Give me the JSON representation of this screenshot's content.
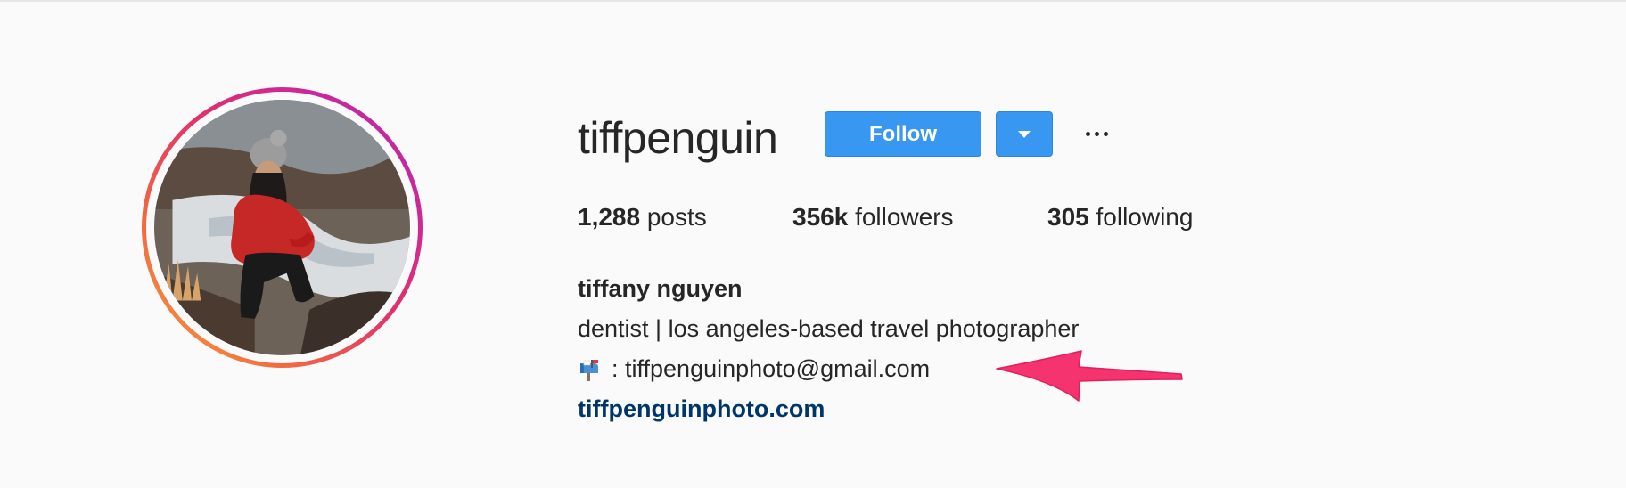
{
  "profile": {
    "username": "tiffpenguin",
    "follow_label": "Follow",
    "avatar_alt": "profile-photo",
    "dropdown_icon": "caret-down-icon",
    "more_icon": "ellipsis-icon"
  },
  "stats": {
    "posts_count": "1,288",
    "posts_label": " posts",
    "followers_count": "356k",
    "followers_label": " followers",
    "following_count": "305",
    "following_label": " following"
  },
  "bio": {
    "full_name": "tiffany nguyen",
    "description": "dentist | los angeles-based travel photographer",
    "email_line": ": tiffpenguinphoto@gmail.com",
    "email_icon": "mailbox-icon",
    "website": "tiffpenguinphoto.com"
  },
  "colors": {
    "follow_button": "#3897f0",
    "link": "#003569",
    "annotation_arrow": "#f5336f",
    "story_ring_start": "#f7a23a",
    "story_ring_end": "#b72f9e"
  }
}
